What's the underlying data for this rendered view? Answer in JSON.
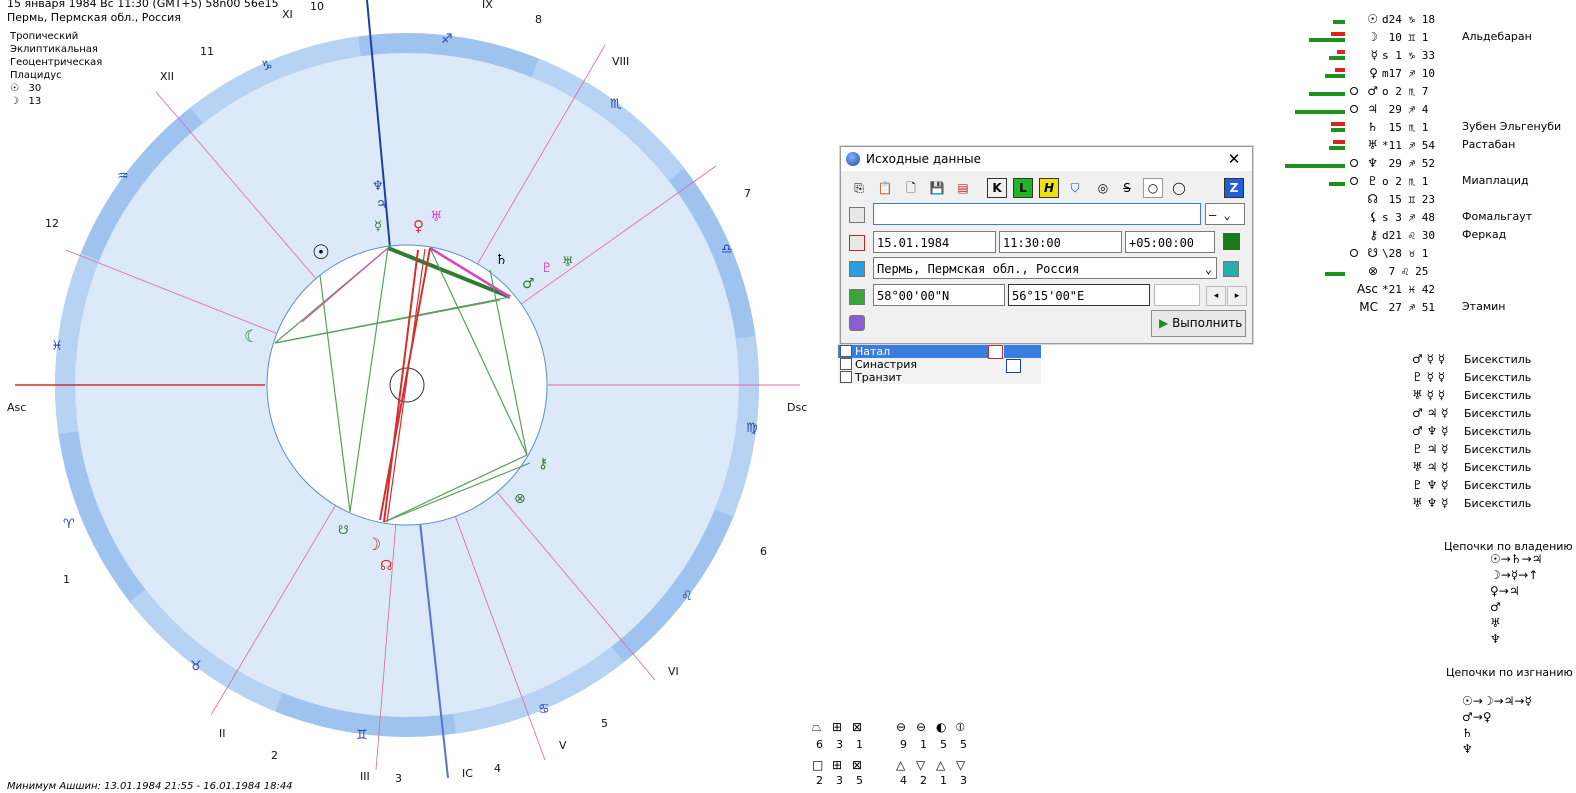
{
  "header": {
    "date_line": "15 января 1984  Вс  11:30 (GMT+5) 58n00  56e15",
    "place_line": "Пермь, Пермская обл., Россия",
    "settings": [
      "Тропический",
      "Эклиптикальная",
      "Геоцентрическая",
      "Плацидус"
    ],
    "sun_row": "30",
    "moon_row": "13"
  },
  "footer": {
    "minimum_text": "Минимум Ашшин: 13.01.1984 21:55 - 16.01.1984 18:44"
  },
  "chart": {
    "house_labels": [
      "XI",
      "IX",
      "XII",
      "VIII",
      "12",
      "7",
      "Asc",
      "Dsc",
      "1",
      "6",
      "II",
      "VI",
      "2",
      "V",
      "III",
      "3",
      "IC",
      "4",
      "5",
      "11",
      "8",
      "10"
    ],
    "angle_asc": "Asc",
    "angle_dsc": "Dsc",
    "angle_ic": "IC"
  },
  "planets": [
    {
      "sym": "☉",
      "pos": "d24 ♑ 18",
      "star": ""
    },
    {
      "sym": "☽",
      "pos": " 10 ♊  1",
      "star": "Альдебаран"
    },
    {
      "sym": "☿",
      "pos": "s 1 ♑ 33",
      "star": ""
    },
    {
      "sym": "♀",
      "pos": "m17 ♐ 10",
      "star": ""
    },
    {
      "sym": "♂",
      "pos": "o 2 ♏  7",
      "star": ""
    },
    {
      "sym": "♃",
      "pos": " 29 ♐  4",
      "star": ""
    },
    {
      "sym": "♄",
      "pos": " 15 ♏  1",
      "star": "Зубен Эльгенуби"
    },
    {
      "sym": "♅",
      "pos": "*11 ♐ 54",
      "star": "Растабан"
    },
    {
      "sym": "♆",
      "pos": " 29 ♐ 52",
      "star": ""
    },
    {
      "sym": "♇",
      "pos": "o 2 ♏  1",
      "star": "Миаплацид"
    },
    {
      "sym": "☊",
      "pos": " 15 ♊ 23",
      "star": ""
    },
    {
      "sym": "⚸",
      "pos": "s 3 ♐ 48",
      "star": "Фомальгаут"
    },
    {
      "sym": "⚷",
      "pos": "d21 ♌ 30",
      "star": "Феркад"
    },
    {
      "sym": "☋",
      "pos": "\\28 ♉  1",
      "star": ""
    },
    {
      "sym": "⊗",
      "pos": " 7 ♌ 25",
      "star": ""
    },
    {
      "sym": "Asc",
      "pos": "*21 ♓ 42",
      "star": ""
    },
    {
      "sym": "MC",
      "pos": " 27 ♐ 51",
      "star": "Этамин"
    }
  ],
  "planet_bars": [
    {
      "g": 12,
      "r": 0,
      "dot": true
    },
    {
      "g": 36,
      "r": 14
    },
    {
      "g": 16,
      "r": 8
    },
    {
      "g": 20,
      "r": 10
    },
    {
      "g": 36,
      "r": 0,
      "ring": true
    },
    {
      "g": 50,
      "r": 0,
      "ring": true
    },
    {
      "g": 14,
      "r": 14
    },
    {
      "g": 16,
      "r": 12
    },
    {
      "g": 60,
      "r": 0,
      "ring": true
    },
    {
      "g": 16,
      "r": 0,
      "ring": true
    },
    {
      "g": 0,
      "r": 0
    },
    {
      "g": 0,
      "r": 0
    },
    {
      "g": 0,
      "r": 0
    },
    {
      "g": 0,
      "r": 0,
      "ring": true
    },
    {
      "g": 20,
      "r": 0
    },
    {
      "g": 0,
      "r": 0
    },
    {
      "g": 0,
      "r": 0
    }
  ],
  "aspects": [
    {
      "syms": "♂ ☿ ☿",
      "name": "Бисекстиль"
    },
    {
      "syms": "♇ ☿ ☿",
      "name": "Бисекстиль"
    },
    {
      "syms": "♅ ☿ ☿",
      "name": "Бисекстиль"
    },
    {
      "syms": "♂ ♃ ☿",
      "name": "Бисекстиль"
    },
    {
      "syms": "♂ ♆ ☿",
      "name": "Бисекстиль"
    },
    {
      "syms": "♇ ♃ ☿",
      "name": "Бисекстиль"
    },
    {
      "syms": "♅ ♃ ☿",
      "name": "Бисекстиль"
    },
    {
      "syms": "♇ ♆ ☿",
      "name": "Бисекстиль"
    },
    {
      "syms": "♅ ♆ ☿",
      "name": "Бисекстиль"
    }
  ],
  "chains": {
    "rulership_title": "Цепочки по владению",
    "exile_title": "Цепочки по изгнанию",
    "rulership_rows": [
      "☉→♄→♃",
      "☽→☿→↑",
      "♀→♃",
      "♂",
      "♅",
      "♆"
    ],
    "exile_rows": [
      "☉→☽→♃→☿",
      "♂→♀",
      "♄",
      "♆"
    ]
  },
  "dialog": {
    "title": "Исходные данные",
    "name_value": "",
    "gender_value": "–",
    "date_value": "15.01.1984",
    "time_value": "11:30:00",
    "tz_value": "+05:00:00",
    "place_value": "Пермь, Пермская обл., Россия",
    "lat_value": "58°00'00\"N",
    "lon_value": "56°15'00\"E",
    "extra_value": "",
    "run_label": "Выполнить",
    "toolbar": [
      "K",
      "L",
      "H",
      "Z"
    ],
    "tabs": [
      {
        "label": "Натал",
        "checked": true
      },
      {
        "label": "Синастрия",
        "checked": false
      },
      {
        "label": "Транзит",
        "checked": false
      }
    ]
  },
  "stats": {
    "row1_nums": [
      "6",
      "3",
      "1",
      "9",
      "1",
      "5",
      "5"
    ],
    "row2_nums": [
      "2",
      "3",
      "5",
      "4",
      "2",
      "1",
      "3"
    ]
  },
  "colors": {
    "ring": "#9fc3ef",
    "ring_inner": "#dbe9f8",
    "green": "#2e7d32",
    "red": "#d32f2f",
    "magenta": "#e040c0",
    "blue": "#1e3fa8"
  }
}
